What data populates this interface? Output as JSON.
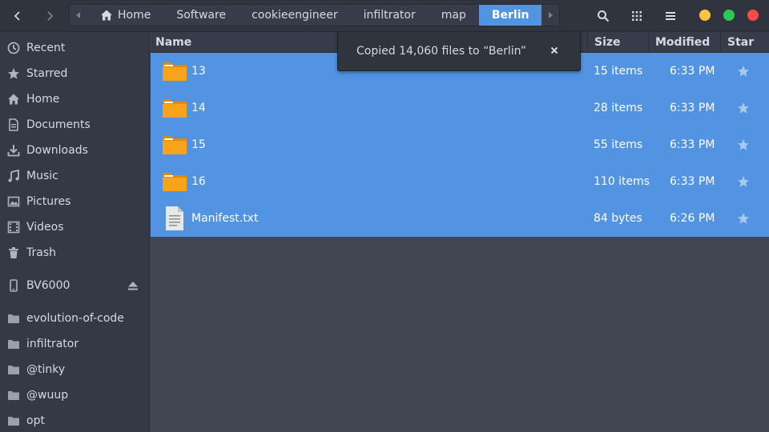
{
  "pathbar": {
    "items": [
      "Home",
      "Software",
      "cookieengineer",
      "infiltrator",
      "map",
      "Berlin"
    ]
  },
  "window_buttons": {
    "minimize_color": "#f7c443",
    "maximize_color": "#2bc854",
    "close_color": "#f64b4b"
  },
  "accent_color": "#5294e2",
  "sidebar": {
    "items": [
      {
        "label": "Recent",
        "icon": "clock-icon"
      },
      {
        "label": "Starred",
        "icon": "star-icon"
      },
      {
        "label": "Home",
        "icon": "home-icon"
      },
      {
        "label": "Documents",
        "icon": "document-icon"
      },
      {
        "label": "Downloads",
        "icon": "download-icon"
      },
      {
        "label": "Music",
        "icon": "music-icon"
      },
      {
        "label": "Pictures",
        "icon": "picture-icon"
      },
      {
        "label": "Videos",
        "icon": "video-icon"
      },
      {
        "label": "Trash",
        "icon": "trash-icon"
      }
    ],
    "devices": [
      {
        "label": "BV6000",
        "icon": "phone-icon"
      }
    ],
    "bookmarks": [
      {
        "label": "evolution-of-code",
        "icon": "folder-icon"
      },
      {
        "label": "infiltrator",
        "icon": "folder-icon"
      },
      {
        "label": "@tinky",
        "icon": "folder-icon"
      },
      {
        "label": "@wuup",
        "icon": "folder-icon"
      },
      {
        "label": "opt",
        "icon": "folder-icon"
      }
    ]
  },
  "columns": {
    "name": "Name",
    "size": "Size",
    "modified": "Modified",
    "star": "Star"
  },
  "files": [
    {
      "name": "13",
      "size": "15 items",
      "modified": "6:33 PM",
      "type": "folder"
    },
    {
      "name": "14",
      "size": "28 items",
      "modified": "6:33 PM",
      "type": "folder"
    },
    {
      "name": "15",
      "size": "55 items",
      "modified": "6:33 PM",
      "type": "folder"
    },
    {
      "name": "16",
      "size": "110 items",
      "modified": "6:33 PM",
      "type": "folder"
    },
    {
      "name": "Manifest.txt",
      "size": "84 bytes",
      "modified": "6:26 PM",
      "type": "text-file"
    }
  ],
  "toast": {
    "message": "Copied 14,060 files to “Berlin”"
  }
}
